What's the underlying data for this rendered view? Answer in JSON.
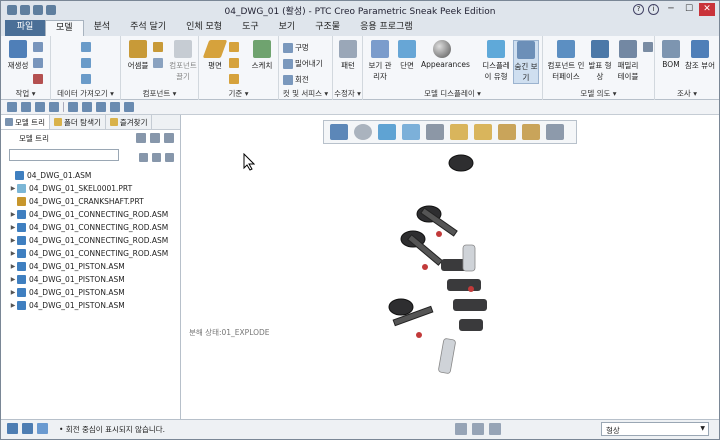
{
  "window": {
    "title": "04_DWG_01 (활성) - PTC Creo Parametric Sneak Peek Edition"
  },
  "tabs": [
    {
      "label": "파일"
    },
    {
      "label": "모델"
    },
    {
      "label": "분석"
    },
    {
      "label": "주석 달기"
    },
    {
      "label": "인체 모형"
    },
    {
      "label": "도구"
    },
    {
      "label": "보기"
    },
    {
      "label": "구조물"
    },
    {
      "label": "응용 프로그램"
    }
  ],
  "ribbon": {
    "groups": [
      {
        "label": "작업 ▾"
      },
      {
        "label": "데이터 가져오기 ▾"
      },
      {
        "label": "컴포넌트 ▾"
      },
      {
        "label": "기준 ▾"
      },
      {
        "label": "컷 및 서피스 ▾"
      },
      {
        "label": "수정자 ▾"
      },
      {
        "label": "모델 디스플레이 ▾"
      },
      {
        "label": "모델 의도 ▾"
      },
      {
        "label": "조사 ▾"
      }
    ],
    "buttons": {
      "regenerate": "재생성",
      "assemble": "어셈블",
      "drag_components": "컴포넌트 끌기",
      "plane": "평면",
      "sketch": "스케치",
      "hole": "구멍",
      "extrude": "밀어내기",
      "revolve": "회전",
      "pattern": "패턴",
      "view_manager": "보기 관리자",
      "section": "단면",
      "appearances": "Appearances",
      "display_style": "디스플레이 유형",
      "hidden_line": "숨긴 보기",
      "component_interface": "컴포넌트 인터페이스",
      "publish_geometry": "발표 형상",
      "family_table": "패밀리 테이블",
      "bom": "BOM",
      "reference_viewer": "참조 뷰어"
    }
  },
  "left_panel": {
    "tabs": [
      {
        "label": "모델 트리"
      },
      {
        "label": "폴더 탐색기"
      },
      {
        "label": "즐겨찾기"
      }
    ],
    "tree_header": "모델 트리",
    "items": [
      {
        "label": "04_DWG_01.ASM",
        "type": "asm",
        "expand": "",
        "indent": 0
      },
      {
        "label": "04_DWG_01_SKEL0001.PRT",
        "type": "prt2",
        "expand": "▶",
        "indent": 1
      },
      {
        "label": "04_DWG_01_CRANKSHAFT.PRT",
        "type": "prt",
        "expand": "",
        "indent": 1
      },
      {
        "label": "04_DWG_01_CONNECTING_ROD.ASM",
        "type": "asm",
        "expand": "▶",
        "indent": 1
      },
      {
        "label": "04_DWG_01_CONNECTING_ROD.ASM",
        "type": "asm",
        "expand": "▶",
        "indent": 1
      },
      {
        "label": "04_DWG_01_CONNECTING_ROD.ASM",
        "type": "asm",
        "expand": "▶",
        "indent": 1
      },
      {
        "label": "04_DWG_01_CONNECTING_ROD.ASM",
        "type": "asm",
        "expand": "▶",
        "indent": 1
      },
      {
        "label": "04_DWG_01_PISTON.ASM",
        "type": "asm",
        "expand": "▶",
        "indent": 1
      },
      {
        "label": "04_DWG_01_PISTON.ASM",
        "type": "asm",
        "expand": "▶",
        "indent": 1
      },
      {
        "label": "04_DWG_01_PISTON.ASM",
        "type": "asm",
        "expand": "▶",
        "indent": 1
      },
      {
        "label": "04_DWG_01_PISTON.ASM",
        "type": "asm",
        "expand": "▶",
        "indent": 1
      }
    ]
  },
  "viewport": {
    "explode_state": "분해 상태:01_EXPLODE"
  },
  "status_bar": {
    "message": "• 회전 중심이 표시되지 않습니다.",
    "filter_value": "형상"
  }
}
